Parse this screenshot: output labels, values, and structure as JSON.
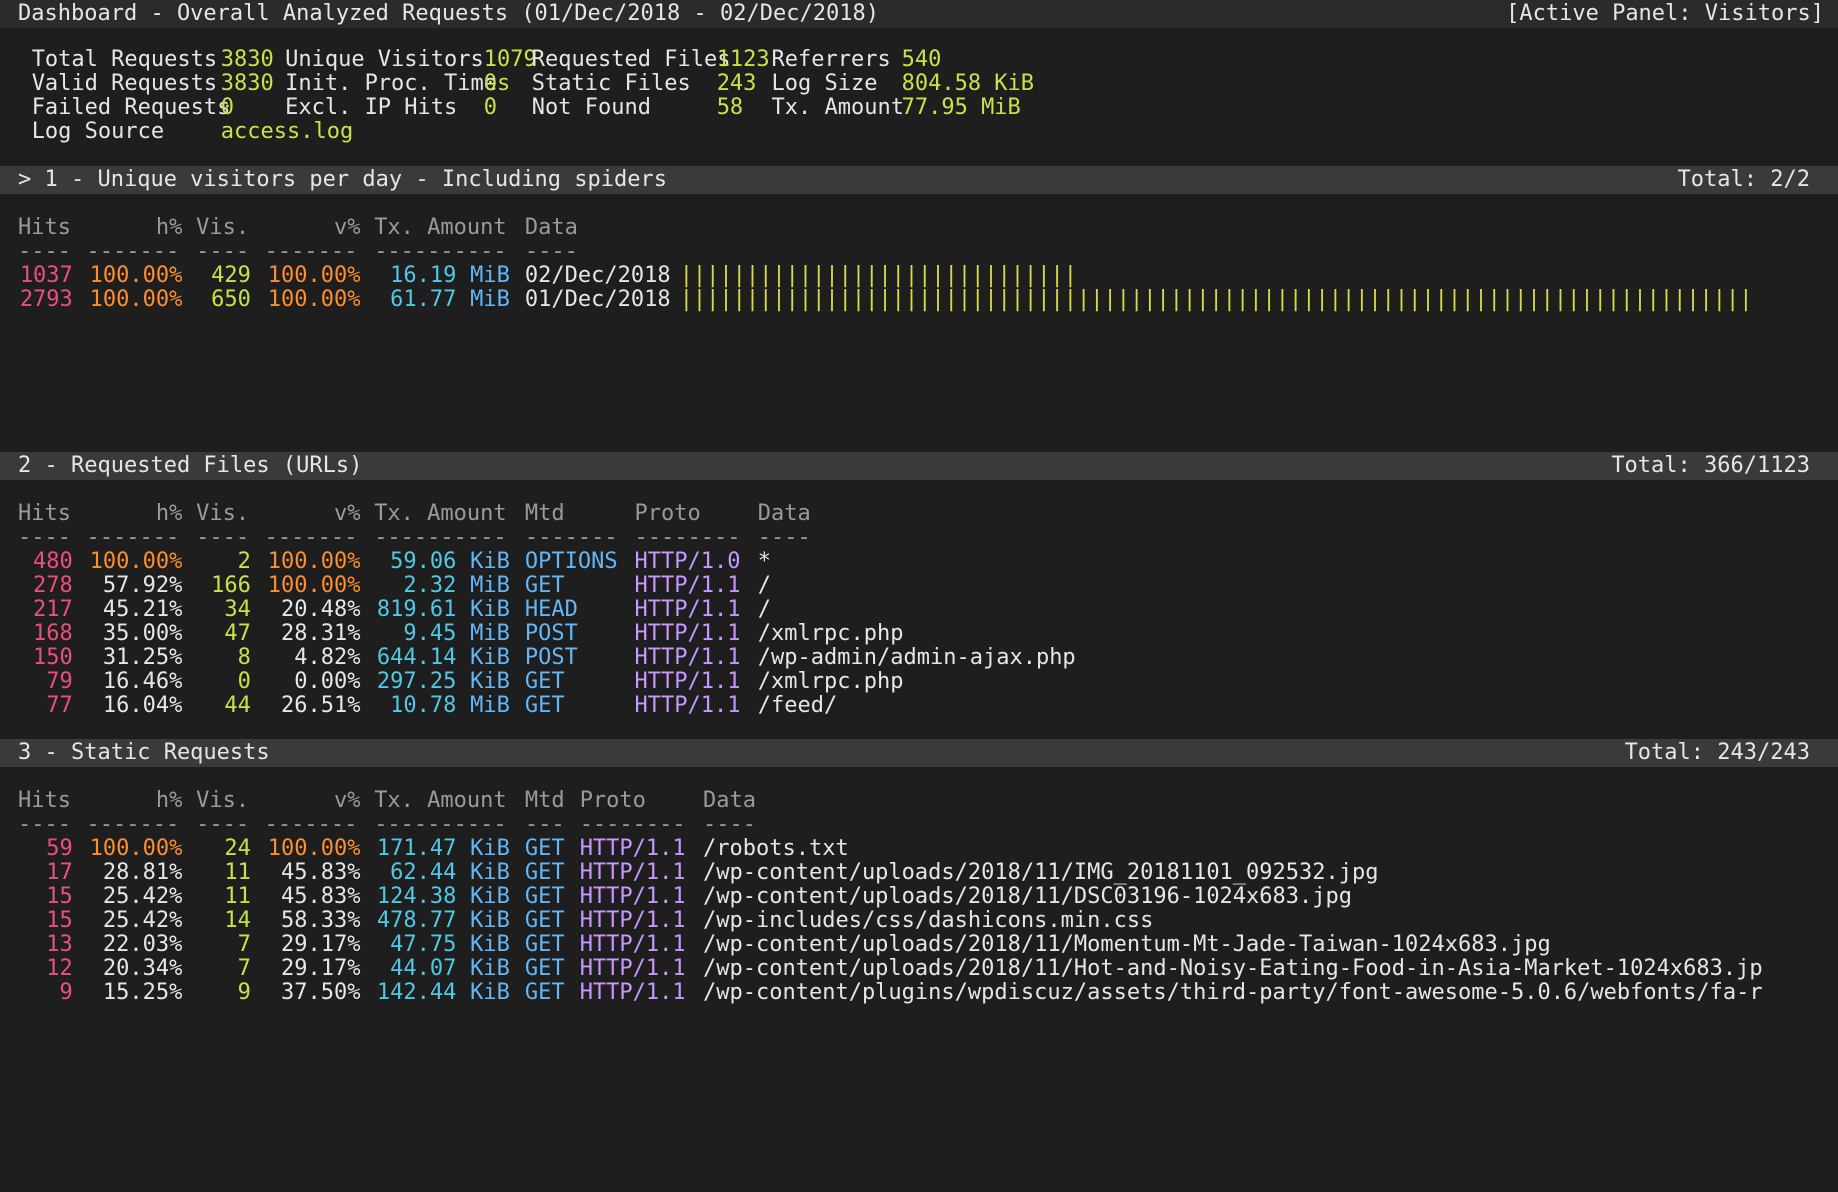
{
  "header": {
    "title": "Dashboard - Overall Analyzed Requests (01/Dec/2018 - 02/Dec/2018)",
    "active_panel": "[Active Panel: Visitors]"
  },
  "overview": {
    "rows": [
      [
        {
          "label": "Total Requests",
          "value": "3830"
        },
        {
          "label": "Unique Visitors",
          "value": "1079"
        },
        {
          "label": "Requested Files",
          "value": "1123"
        },
        {
          "label": "Referrers",
          "value": "540"
        }
      ],
      [
        {
          "label": "Valid Requests",
          "value": "3830"
        },
        {
          "label": "Init. Proc. Time",
          "value": "0s"
        },
        {
          "label": "Static Files",
          "value": "243"
        },
        {
          "label": "Log Size",
          "value": "804.58 KiB"
        }
      ],
      [
        {
          "label": "Failed Requests",
          "value": "0"
        },
        {
          "label": "Excl. IP Hits",
          "value": "0"
        },
        {
          "label": "Not Found",
          "value": "58"
        },
        {
          "label": "Tx. Amount",
          "value": "77.95 MiB"
        }
      ]
    ],
    "log_source_label": "Log Source",
    "log_source_value": "access.log"
  },
  "panels": {
    "visitors": {
      "title": "> 1 - Unique visitors per day - Including spiders",
      "total": "Total: 2/2",
      "headers": {
        "hits": "Hits",
        "hp": "h%",
        "vis": "Vis.",
        "vp": "v%",
        "tx": "Tx. Amount",
        "data": "Data"
      },
      "rules": {
        "hits": "----",
        "hp": "-------",
        "vis": "----",
        "vp": "-------",
        "tx": "----------",
        "data": "----"
      },
      "rows": [
        {
          "hits": "1037",
          "hp": "100.00%",
          "vis": "429",
          "vp": "100.00%",
          "tx": "16.19",
          "unit": "MiB",
          "data": "02/Dec/2018",
          "bar": 30
        },
        {
          "hits": "2793",
          "hp": "100.00%",
          "vis": "650",
          "vp": "100.00%",
          "tx": "61.77",
          "unit": "MiB",
          "data": "01/Dec/2018",
          "bar": 81
        }
      ]
    },
    "requests": {
      "title": "2 - Requested Files (URLs)",
      "total": "Total: 366/1123",
      "headers": {
        "hits": "Hits",
        "hp": "h%",
        "vis": "Vis.",
        "vp": "v%",
        "tx": "Tx. Amount",
        "mtd": "Mtd",
        "proto": "Proto",
        "data": "Data"
      },
      "rules": {
        "hits": "----",
        "hp": "-------",
        "vis": "----",
        "vp": "-------",
        "tx": "----------",
        "mtd": "-------",
        "proto": "--------",
        "data": "----"
      },
      "rows": [
        {
          "hits": "480",
          "hp": "100.00%",
          "vis": "2",
          "vp": "100.00%",
          "tx": "59.06",
          "unit": "KiB",
          "mtd": "OPTIONS",
          "proto": "HTTP/1.0",
          "data": "*"
        },
        {
          "hits": "278",
          "hp": "57.92%",
          "vis": "166",
          "vp": "100.00%",
          "tx": "2.32",
          "unit": "MiB",
          "mtd": "GET",
          "proto": "HTTP/1.1",
          "data": "/"
        },
        {
          "hits": "217",
          "hp": "45.21%",
          "vis": "34",
          "vp": "20.48%",
          "tx": "819.61",
          "unit": "KiB",
          "mtd": "HEAD",
          "proto": "HTTP/1.1",
          "data": "/"
        },
        {
          "hits": "168",
          "hp": "35.00%",
          "vis": "47",
          "vp": "28.31%",
          "tx": "9.45",
          "unit": "MiB",
          "mtd": "POST",
          "proto": "HTTP/1.1",
          "data": "/xmlrpc.php"
        },
        {
          "hits": "150",
          "hp": "31.25%",
          "vis": "8",
          "vp": "4.82%",
          "tx": "644.14",
          "unit": "KiB",
          "mtd": "POST",
          "proto": "HTTP/1.1",
          "data": "/wp-admin/admin-ajax.php"
        },
        {
          "hits": "79",
          "hp": "16.46%",
          "vis": "0",
          "vp": "0.00%",
          "tx": "297.25",
          "unit": "KiB",
          "mtd": "GET",
          "proto": "HTTP/1.1",
          "data": "/xmlrpc.php"
        },
        {
          "hits": "77",
          "hp": "16.04%",
          "vis": "44",
          "vp": "26.51%",
          "tx": "10.78",
          "unit": "MiB",
          "mtd": "GET",
          "proto": "HTTP/1.1",
          "data": "/feed/"
        }
      ]
    },
    "static": {
      "title": "3 - Static Requests",
      "total": "Total: 243/243",
      "headers": {
        "hits": "Hits",
        "hp": "h%",
        "vis": "Vis.",
        "vp": "v%",
        "tx": "Tx. Amount",
        "mtd": "Mtd",
        "proto": "Proto",
        "data": "Data"
      },
      "rules": {
        "hits": "----",
        "hp": "-------",
        "vis": "----",
        "vp": "-------",
        "tx": "----------",
        "mtd": "---",
        "proto": "--------",
        "data": "----"
      },
      "rows": [
        {
          "hits": "59",
          "hp": "100.00%",
          "vis": "24",
          "vp": "100.00%",
          "tx": "171.47",
          "unit": "KiB",
          "mtd": "GET",
          "proto": "HTTP/1.1",
          "data": "/robots.txt"
        },
        {
          "hits": "17",
          "hp": "28.81%",
          "vis": "11",
          "vp": "45.83%",
          "tx": "62.44",
          "unit": "KiB",
          "mtd": "GET",
          "proto": "HTTP/1.1",
          "data": "/wp-content/uploads/2018/11/IMG_20181101_092532.jpg"
        },
        {
          "hits": "15",
          "hp": "25.42%",
          "vis": "11",
          "vp": "45.83%",
          "tx": "124.38",
          "unit": "KiB",
          "mtd": "GET",
          "proto": "HTTP/1.1",
          "data": "/wp-content/uploads/2018/11/DSC03196-1024x683.jpg"
        },
        {
          "hits": "15",
          "hp": "25.42%",
          "vis": "14",
          "vp": "58.33%",
          "tx": "478.77",
          "unit": "KiB",
          "mtd": "GET",
          "proto": "HTTP/1.1",
          "data": "/wp-includes/css/dashicons.min.css"
        },
        {
          "hits": "13",
          "hp": "22.03%",
          "vis": "7",
          "vp": "29.17%",
          "tx": "47.75",
          "unit": "KiB",
          "mtd": "GET",
          "proto": "HTTP/1.1",
          "data": "/wp-content/uploads/2018/11/Momentum-Mt-Jade-Taiwan-1024x683.jpg"
        },
        {
          "hits": "12",
          "hp": "20.34%",
          "vis": "7",
          "vp": "29.17%",
          "tx": "44.07",
          "unit": "KiB",
          "mtd": "GET",
          "proto": "HTTP/1.1",
          "data": "/wp-content/uploads/2018/11/Hot-and-Noisy-Eating-Food-in-Asia-Market-1024x683.jp"
        },
        {
          "hits": "9",
          "hp": "15.25%",
          "vis": "9",
          "vp": "37.50%",
          "tx": "142.44",
          "unit": "KiB",
          "mtd": "GET",
          "proto": "HTTP/1.1",
          "data": "/wp-content/plugins/wpdiscuz/assets/third-party/font-awesome-5.0.6/webfonts/fa-r"
        }
      ]
    }
  },
  "colors": {
    "background": "#1e1e1e",
    "panel_bar": "#3a3a3a",
    "hits": "#ec4f79",
    "percent_full": "#fd8f2c",
    "visitors": "#c6e447",
    "tx": "#4fc9e5",
    "method": "#63b6f7",
    "proto": "#c897ff",
    "bar": "#d6d94a"
  }
}
